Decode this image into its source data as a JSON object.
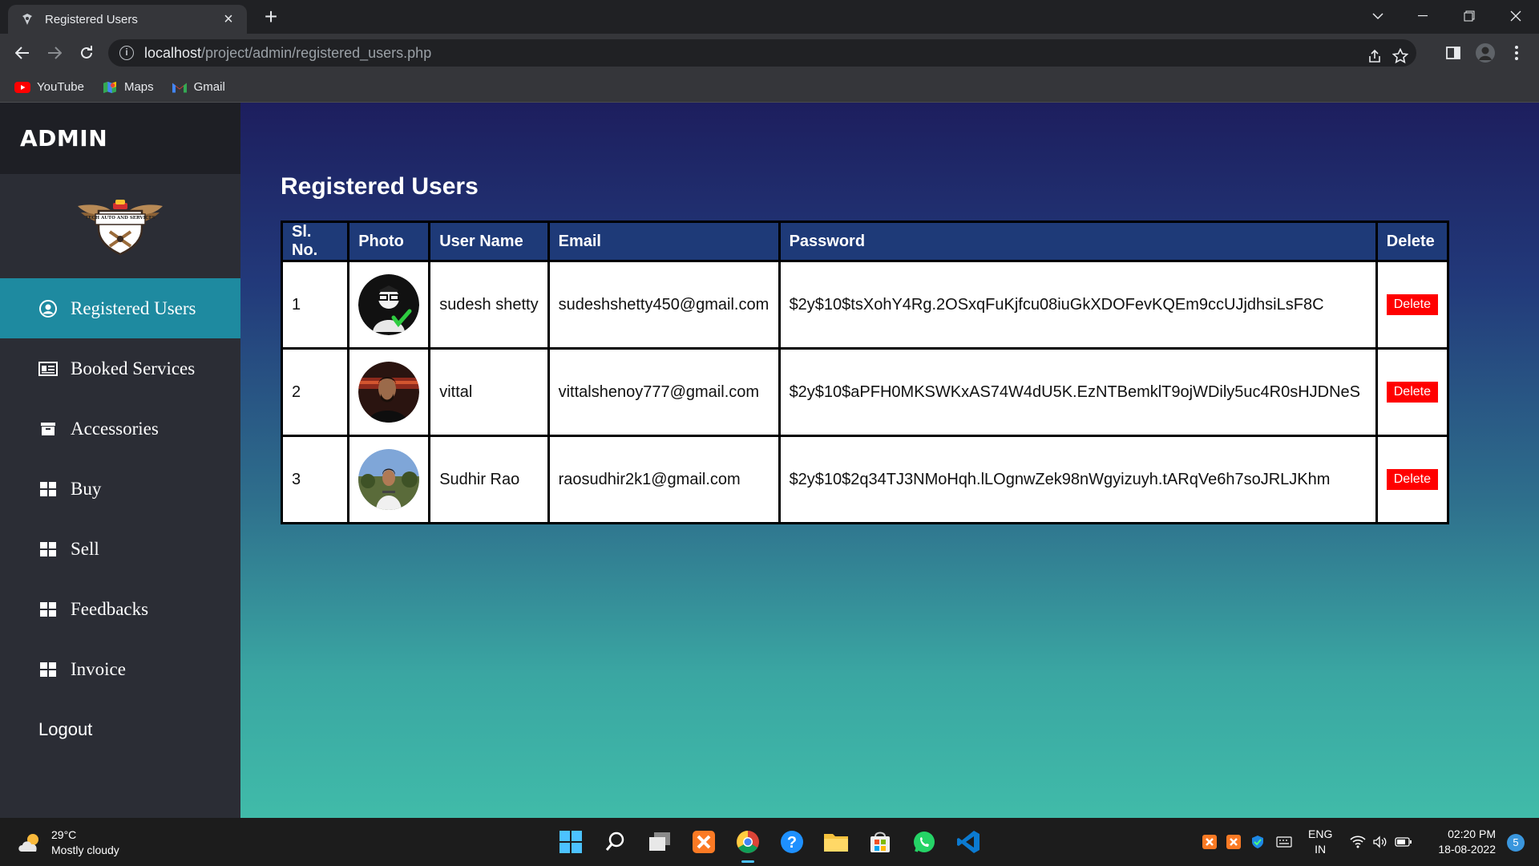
{
  "browser": {
    "tab_title": "Registered Users",
    "url_host": "localhost",
    "url_path": "/project/admin/registered_users.php",
    "bookmarks": [
      {
        "label": "YouTube",
        "icon": "youtube-icon"
      },
      {
        "label": "Maps",
        "icon": "maps-icon"
      },
      {
        "label": "Gmail",
        "icon": "gmail-icon"
      }
    ]
  },
  "sidebar": {
    "title": "ADMIN",
    "logo_text": "TECH AUTO AND SERVICES",
    "items": [
      {
        "label": "Registered Users",
        "icon": "user-circle-icon",
        "active": true
      },
      {
        "label": "Booked Services",
        "icon": "id-card-icon"
      },
      {
        "label": "Accessories",
        "icon": "box-icon"
      },
      {
        "label": "Buy",
        "icon": "grid-icon"
      },
      {
        "label": "Sell",
        "icon": "grid-icon"
      },
      {
        "label": "Feedbacks",
        "icon": "grid-icon"
      },
      {
        "label": "Invoice",
        "icon": "grid-icon"
      }
    ],
    "logout_label": "Logout"
  },
  "main": {
    "title": "Registered Users",
    "columns": [
      "Sl. No.",
      "Photo",
      "User Name",
      "Email",
      "Password",
      "Delete"
    ],
    "rows": [
      {
        "sl": "1",
        "name": "sudesh shetty",
        "email": "sudeshshetty450@gmail.com",
        "password": "$2y$10$tsXohY4Rg.2OSxqFuKjfcu08iuGkXDOFevKQEm9ccUJjdhsiLsF8C",
        "delete_label": "Delete"
      },
      {
        "sl": "2",
        "name": "vittal",
        "email": "vittalshenoy777@gmail.com",
        "password": "$2y$10$aPFH0MKSWKxAS74W4dU5K.EzNTBemklT9ojWDily5uc4R0sHJDNeS",
        "delete_label": "Delete"
      },
      {
        "sl": "3",
        "name": "Sudhir Rao",
        "email": "raosudhir2k1@gmail.com",
        "password": "$2y$10$2q34TJ3NMoHqh.lLOgnwZek98nWgyizuyh.tARqVe6h7soJRLJKhm",
        "delete_label": "Delete"
      }
    ]
  },
  "taskbar": {
    "temperature": "29°C",
    "weather": "Mostly cloudy",
    "language": "ENG",
    "region": "IN",
    "time": "02:20 PM",
    "date": "18-08-2022",
    "notification_count": "5"
  },
  "colors": {
    "sidebar_active": "#1e8aa0",
    "delete_button": "#ff0000",
    "table_header": "#1e3a78"
  }
}
